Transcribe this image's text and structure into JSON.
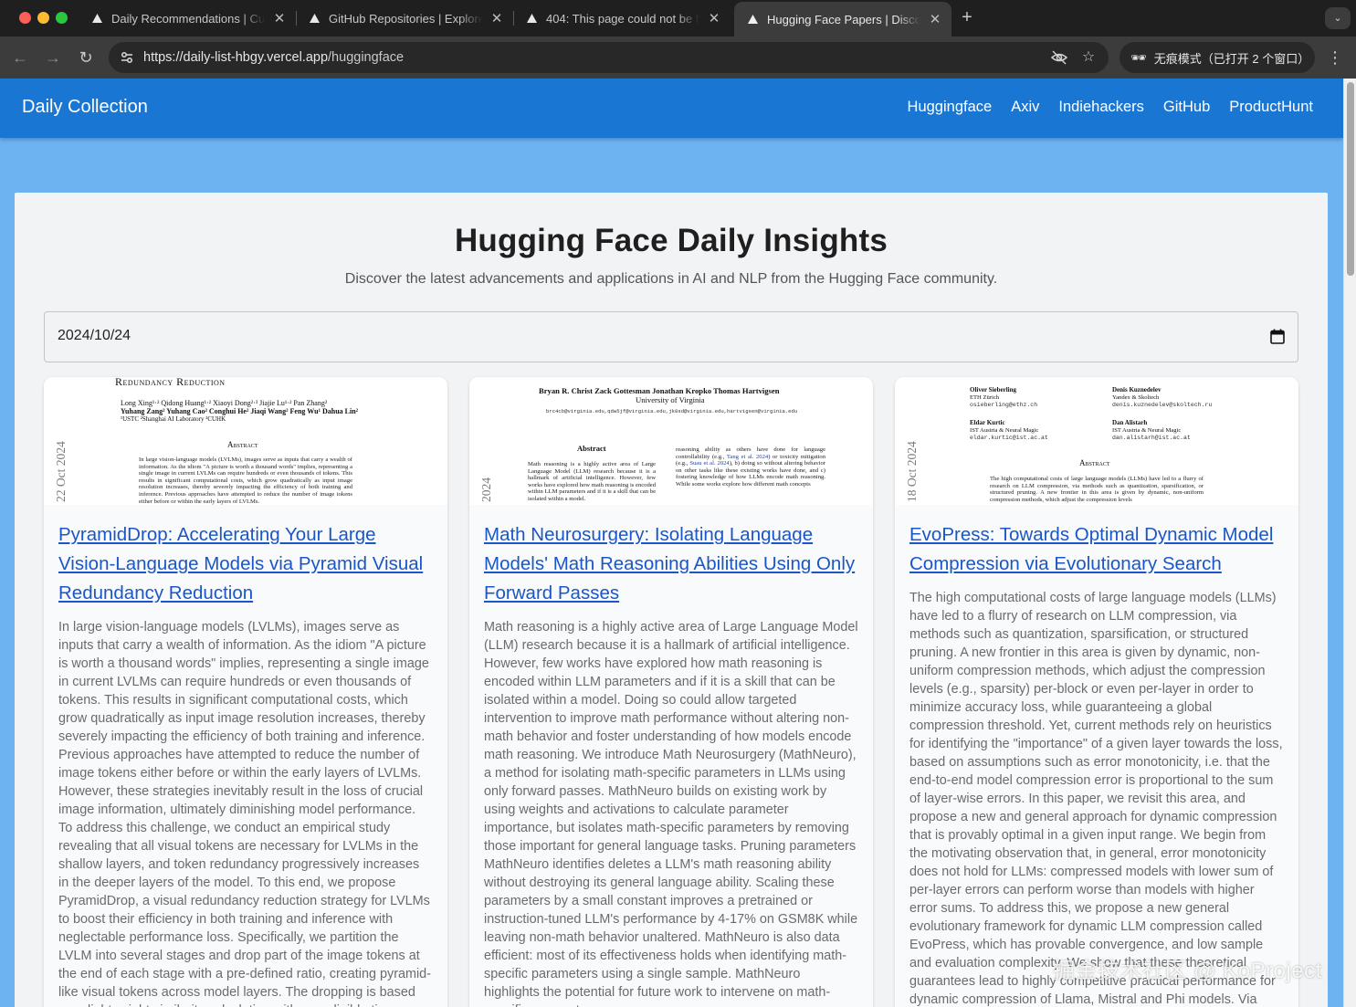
{
  "browser": {
    "tabs": [
      {
        "title": "Daily Recommendations | Cur",
        "active": false
      },
      {
        "title": "GitHub Repositories | Explore",
        "active": false
      },
      {
        "title": "404: This page could not be f",
        "active": false
      },
      {
        "title": "Hugging Face Papers | Discov",
        "active": true
      }
    ],
    "url_host": "https://daily-list-hbgy.vercel.app",
    "url_path": "/huggingface",
    "profile_label": "无痕模式（已打开 2 个窗口）"
  },
  "app": {
    "brand": "Daily Collection",
    "nav": [
      "Huggingface",
      "Axiv",
      "Indiehackers",
      "GitHub",
      "ProductHunt"
    ],
    "colors": {
      "appbar": "#1976d2",
      "background": "#6db3f2",
      "link": "#1a56c8"
    }
  },
  "page": {
    "title": "Hugging Face Daily Insights",
    "subtitle": "Discover the latest advancements and applications in AI and NLP from the Hugging Face community.",
    "date_value": "2024/10/24"
  },
  "cards": [
    {
      "thumb": {
        "side": "22 Oct 2024",
        "heading": "Redundancy Reduction",
        "authors1": "Long Xing¹·²   Qidong Huang¹·²   Xiaoyi Dong²·³   Jiajie Lu¹·²   Pan Zhang²",
        "authors2": "Yuhang Zang²   Yuhang Cao²   Conghui He²   Jiaqi Wang²   Feng Wu¹   Dahua Lin²",
        "affil": "¹USTC   ²Shanghai AI Laboratory   ³CUHK",
        "abstract_head": "Abstract",
        "abstract": "In large vision-language models (LVLMs), images serve as inputs that carry a wealth of information. As the idiom \"A picture is worth a thousand words\" implies, representing a single image in current LVLMs can require hundreds or even thousands of tokens. This results in significant computational costs, which grow quadratically as input image resolution increases, thereby severely impacting the efficiency of both training and inference. Previous approaches have attempted to reduce the number of image tokens either before or within the early layers of LVLMs."
      },
      "title": "PyramidDrop: Accelerating Your Large Vision-Language Models via Pyramid Visual Redundancy Reduction",
      "abstract": "In large vision-language models (LVLMs), images serve as inputs that carry a wealth of information. As the idiom \"A picture is worth a thousand words\" implies, representing a single image in current LVLMs can require hundreds or even thousands of tokens. This results in significant computational costs, which grow quadratically as input image resolution increases, thereby severely impacting the efficiency of both training and inference. Previous approaches have attempted to reduce the number of image tokens either before or within the early layers of LVLMs. However, these strategies inevitably result in the loss of crucial image information, ultimately diminishing model performance. To address this challenge, we conduct an empirical study revealing that all visual tokens are necessary for LVLMs in the shallow layers, and token redundancy progressively increases in the deeper layers of the model. To this end, we propose PyramidDrop, a visual redundancy reduction strategy for LVLMs to boost their efficiency in both training and inference with neglectable performance loss. Specifically, we partition the LVLM into several stages and drop part of the image tokens at the end of each stage with a pre-defined ratio, creating pyramid-like visual tokens across model layers. The dropping is based on a lightweight similarity calculation with a negligible time"
    },
    {
      "thumb": {
        "side": "2024",
        "authors": "Bryan R. Christ    Zack Gottesman    Jonathan Kropko    Thomas Hartvigsen",
        "affil": "University of Virginia",
        "emails": "brc4cb@virginia.edu,qdw5jf@virginia.edu,jk8sd@virginia.edu,hartvigsen@virginia.edu",
        "abstract_head": "Abstract",
        "left_col": "Math reasoning is a highly active area of Large Language Model (LLM) research because it is a hallmark of artificial intelligence. However, few works have explored how math reasoning is encoded within LLM parameters and if it is a skill that can be isolated within a model.",
        "right_col_1": "reasoning ability as others have done for language controllability (e.g., ",
        "right_cite_1": "Tang et al. 2024",
        "right_col_2": ") or toxicity mitigation (e.g., ",
        "right_cite_2": "Suau et al. 2024",
        "right_col_3": "), b) doing so without altering behavior on other tasks like these existing works have done, and c) fostering knowledge of how LLMs encode math reasoning. While some works explore how different math concepts"
      },
      "title": "Math Neurosurgery: Isolating Language Models' Math Reasoning Abilities Using Only Forward Passes",
      "abstract": "Math reasoning is a highly active area of Large Language Model (LLM) research because it is a hallmark of artificial intelligence. However, few works have explored how math reasoning is encoded within LLM parameters and if it is a skill that can be isolated within a model. Doing so could allow targeted intervention to improve math performance without altering non-math behavior and foster understanding of how models encode math reasoning. We introduce Math Neurosurgery (MathNeuro), a method for isolating math-specific parameters in LLMs using only forward passes. MathNeuro builds on existing work by using weights and activations to calculate parameter importance, but isolates math-specific parameters by removing those important for general language tasks. Pruning parameters MathNeuro identifies deletes a LLM's math reasoning ability without destroying its general language ability. Scaling these parameters by a small constant improves a pretrained or instruction-tuned LLM's performance by 4-17% on GSM8K while leaving non-math behavior unaltered. MathNeuro is also data efficient: most of its effectiveness holds when identifying math-specific parameters using a single sample. MathNeuro highlights the potential for future work to intervene on math-specific parameters."
    },
    {
      "thumb": {
        "side": "18 Oct 2024",
        "a1_name": "Oliver Sieberling",
        "a1_affil": "ETH Zürich",
        "a1_email": "osieberling@ethz.ch",
        "a2_name": "Denis Kuznedelev",
        "a2_affil": "Yandex & Skoltech",
        "a2_email": "denis.kuznedelev@skoltech.ru",
        "a3_name": "Eldar Kurtic",
        "a3_affil": "IST Austria & Neural Magic",
        "a3_email": "eldar.kurtic@ist.ac.at",
        "a4_name": "Dan Alistarh",
        "a4_affil": "IST Austria & Neural Magic",
        "a4_email": "dan.alistarh@ist.ac.at",
        "abstract_head": "Abstract",
        "abstract": "The high computational costs of large language models (LLMs) have led to a flurry of research on LLM compression, via methods such as quantization, sparsification, or structured pruning. A new frontier in this area is given by dynamic, non-uniform compression methods, which adjust the compression levels"
      },
      "title": "EvoPress: Towards Optimal Dynamic Model Compression via Evolutionary Search",
      "abstract": "The high computational costs of large language models (LLMs) have led to a flurry of research on LLM compression, via methods such as quantization, sparsification, or structured pruning. A new frontier in this area is given by dynamic, non-uniform compression methods, which adjust the compression levels (e.g., sparsity) per-block or even per-layer in order to minimize accuracy loss, while guaranteeing a global compression threshold. Yet, current methods rely on heuristics for identifying the \"importance\" of a given layer towards the loss, based on assumptions such as error monotonicity, i.e. that the end-to-end model compression error is proportional to the sum of layer-wise errors. In this paper, we revisit this area, and propose a new and general approach for dynamic compression that is provably optimal in a given input range. We begin from the motivating observation that, in general, error monotonicity does not hold for LLMs: compressed models with lower sum of per-layer errors can perform worse than models with higher error sums. To address this, we propose a new general evolutionary framework for dynamic LLM compression called EvoPress, which has provable convergence, and low sample and evaluation complexity. We show that these theoretical guarantees lead to highly competitive practical performance for dynamic compression of Llama, Mistral and Phi models. Via"
    }
  ],
  "watermark": "掘金技术社区 @ KoProject"
}
